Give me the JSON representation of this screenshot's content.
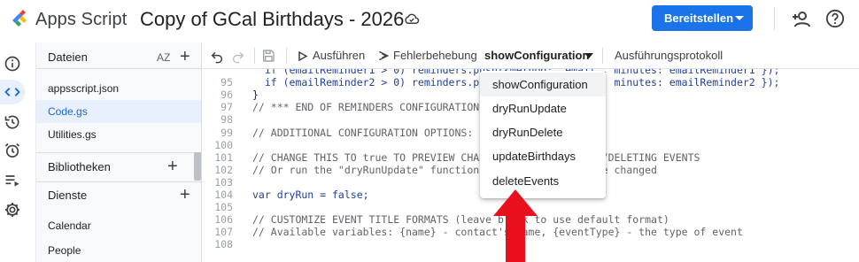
{
  "header": {
    "app_name": "Apps Script",
    "project_title": "Copy of GCal Birthdays - 2026",
    "deploy_label": "Bereitstellen"
  },
  "sidebar": {
    "files_header": "Dateien",
    "sort_label": "AZ",
    "files": [
      "appsscript.json",
      "Code.gs",
      "Utilities.gs"
    ],
    "active_file": "Code.gs",
    "libraries_header": "Bibliotheken",
    "services_header": "Dienste",
    "services": [
      "Calendar",
      "People"
    ]
  },
  "toolbar": {
    "run_label": "Ausführen",
    "debug_label": "Fehlerbehebung",
    "selected_function": "showConfiguration",
    "log_label": "Ausführungsprotokoll"
  },
  "editor": {
    "lines": [
      {
        "n": "",
        "text": "  if (emailReminder1 > 0) reminders.push({method: 'email', minutes: emailReminder1 });"
      },
      {
        "n": "95",
        "text": "  if (emailReminder2 > 0) reminders.push({method: 'email', minutes: emailReminder2 });"
      },
      {
        "n": "96",
        "text": "}"
      },
      {
        "n": "97",
        "text": "// *** END OF REMINDERS CONFIGURATION ***"
      },
      {
        "n": "98",
        "text": ""
      },
      {
        "n": "99",
        "text": "// ADDITIONAL CONFIGURATION OPTIONS:"
      },
      {
        "n": "100",
        "text": ""
      },
      {
        "n": "101",
        "text": "// CHANGE THIS TO true TO PREVIEW CHANGES BEFORE CREATING/DELETING EVENTS"
      },
      {
        "n": "102",
        "text": "// Or run the \"dryRunUpdate\" function to see what would be changed"
      },
      {
        "n": "103",
        "text": ""
      },
      {
        "n": "104",
        "text": "var dryRun = false;"
      },
      {
        "n": "105",
        "text": ""
      },
      {
        "n": "106",
        "text": "// CUSTOMIZE EVENT TITLE FORMATS (leave blank to use default format)"
      },
      {
        "n": "107",
        "text": "// Available variables: {name} - contact's name, {eventType} - the type of event"
      },
      {
        "n": "108",
        "text": ""
      }
    ]
  },
  "function_menu": {
    "items": [
      "showConfiguration",
      "dryRunUpdate",
      "dryRunDelete",
      "updateBirthdays",
      "deleteEvents"
    ],
    "highlighted": "showConfiguration"
  },
  "colors": {
    "accent": "#1a73e8",
    "active_file_bg": "#e8f0fe",
    "annotation_arrow": "#e8101c"
  }
}
